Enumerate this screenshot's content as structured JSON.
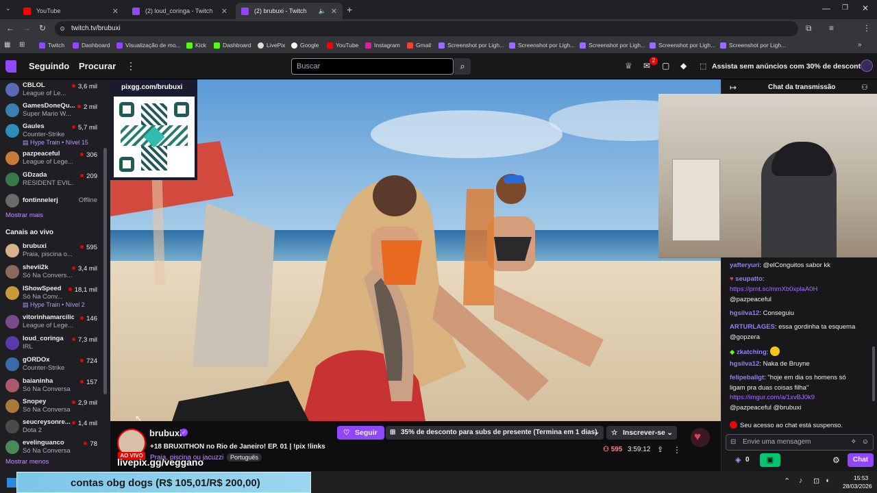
{
  "browser": {
    "tabs": [
      {
        "title": "YouTube",
        "color": "#ff0000"
      },
      {
        "title": "(2) loud_coringa - Twitch",
        "color": "#9146ff"
      },
      {
        "title": "(2) brubuxi - Twitch",
        "color": "#9146ff"
      }
    ],
    "url": "twitch.tv/brubuxi",
    "bookmarks": [
      "Twitch",
      "Dashboard",
      "Visualização de mo...",
      "Kick",
      "Dashboard",
      "LivePix",
      "Google",
      "YouTube",
      "Instagram",
      "Gmail",
      "Screenshot por Ligh...",
      "Screenshot por Ligh...",
      "Screenshot por Ligh...",
      "Screenshot por Ligh...",
      "Screenshot por Ligh..."
    ]
  },
  "twitch_nav": {
    "following": "Seguindo",
    "browse": "Procurar",
    "search_placeholder": "Buscar",
    "notif_count": "2",
    "turbo": "Assista sem anúncios com 30% de desconto"
  },
  "sidebar": {
    "followed": [
      {
        "name": "CBLOL",
        "game": "League of Le...",
        "viewers": "3,6 mil",
        "color": "#5a6bb5"
      },
      {
        "name": "GamesDoneQu...",
        "game": "Super Mario W...",
        "viewers": "2 mil",
        "color": "#3d7fb0"
      },
      {
        "name": "Gaules",
        "game": "Counter-Strike",
        "viewers": "5,7 mil",
        "color": "#2b8fb8",
        "hype": "Hype Train • Nível 15"
      },
      {
        "name": "pazpeaceful",
        "game": "League of Lege...",
        "viewers": "306",
        "color": "#c77a3a"
      },
      {
        "name": "GDzada",
        "game": "RESIDENT EVIL...",
        "viewers": "209",
        "color": "#3a7a4a"
      },
      {
        "name": "fontinnelerj",
        "game": "",
        "viewers": "Offline",
        "color": "#6a6a6a"
      }
    ],
    "show_more": "Mostrar mais",
    "live_header": "Canais ao vivo",
    "live": [
      {
        "name": "brubuxi",
        "game": "Praia, piscina o...",
        "viewers": "595",
        "color": "#d8b08a"
      },
      {
        "name": "shevii2k",
        "game": "Só Na Convers...",
        "viewers": "3,4 mil",
        "color": "#8a6a5a"
      },
      {
        "name": "IShowSpeed",
        "game": "Só Na Conv...",
        "viewers": "18,1 mil",
        "color": "#c89a3a",
        "hype": "Hype Train • Nível 2"
      },
      {
        "name": "vitorinhamarcilio",
        "game": "League of Lege...",
        "viewers": "146",
        "color": "#7a4a8a"
      },
      {
        "name": "loud_coringa",
        "game": "IRL",
        "viewers": "7,3 mil",
        "color": "#5a3aaa"
      },
      {
        "name": "gORDOx",
        "game": "Counter-Strike",
        "viewers": "724",
        "color": "#3a6aaa"
      },
      {
        "name": "baianinha",
        "game": "Só Na Conversa",
        "viewers": "157",
        "color": "#aa5a6a"
      },
      {
        "name": "Snopey",
        "game": "Só Na Conversa",
        "viewers": "2,9 mil",
        "color": "#aa7a3a"
      },
      {
        "name": "seucreysonre...",
        "game": "Dota 2",
        "viewers": "1,4 mil",
        "color": "#4a4a4a"
      },
      {
        "name": "evelinguanco",
        "game": "Só Na Conversa",
        "viewers": "78",
        "color": "#4a8a5a"
      }
    ],
    "show_less": "Mostrar menos"
  },
  "video": {
    "pix_label": "pixgg.com/brubuxi"
  },
  "stream": {
    "channel": "brubuxi",
    "live_badge": "AO VIVO",
    "title": "+18 BRUXITHON no Rio de Janeiro! EP. 01 | !pix !links",
    "category": "Praia, piscina ou jacuzzi",
    "tag": "Português",
    "follow": "Seguir",
    "gift_offer": "35% de desconto para subs de presente (Termina em 1 dias)",
    "subscribe": "Inscrever-se",
    "viewers": "595",
    "uptime": "3:59:12",
    "overlay_link": "livepix.gg/veggano"
  },
  "chat": {
    "header": "Chat da transmissão",
    "messages": [
      {
        "user": "yafteryuri",
        "color": "#9a7bff",
        "text": ": @elConguitos sabor kk"
      },
      {
        "user": "seupatto",
        "color": "#9a7bff",
        "text": ":"
      },
      {
        "user": "",
        "color": "",
        "text": "https://prnt.sc/mmXb0xplaA0H",
        "link": true
      },
      {
        "user": "",
        "color": "",
        "text": "@pazpeaceful"
      },
      {
        "user": "hgsilva12",
        "color": "#9a7bff",
        "text": ": Conseguiu"
      },
      {
        "user": "ARTURLAGES",
        "color": "#9a7bff",
        "text": ": essa gordinha ta esquema"
      },
      {
        "user": "",
        "color": "",
        "text": "@gopzera"
      },
      {
        "user": "zkatching",
        "color": "#9a7bff",
        "text": ":"
      },
      {
        "user": "hgsilva12",
        "color": "#9a7bff",
        "text": ": Naka de Bruyne"
      },
      {
        "user": "felipeballgt",
        "color": "#9a7bff",
        "text": ": \"hoje em dia os homens só"
      },
      {
        "user": "",
        "color": "",
        "text": "ligam pra duas coisas filha\""
      },
      {
        "user": "",
        "color": "",
        "text": "https://imgur.com/a/1xvBJ0k9",
        "link": true
      },
      {
        "user": "",
        "color": "",
        "text": "@pazpeaceful @brubuxi"
      }
    ],
    "suspended": "Seu acesso ao chat está suspenso.",
    "input_placeholder": "Envie uma mensagem",
    "points": "0",
    "chat_button": "Chat"
  },
  "taskbar": {
    "overlay_text": "contas obg dogs (R$ 105,01/R$ 200,00)",
    "time": "15:53",
    "date": "28/03/2026"
  },
  "accent": "#9146ff"
}
